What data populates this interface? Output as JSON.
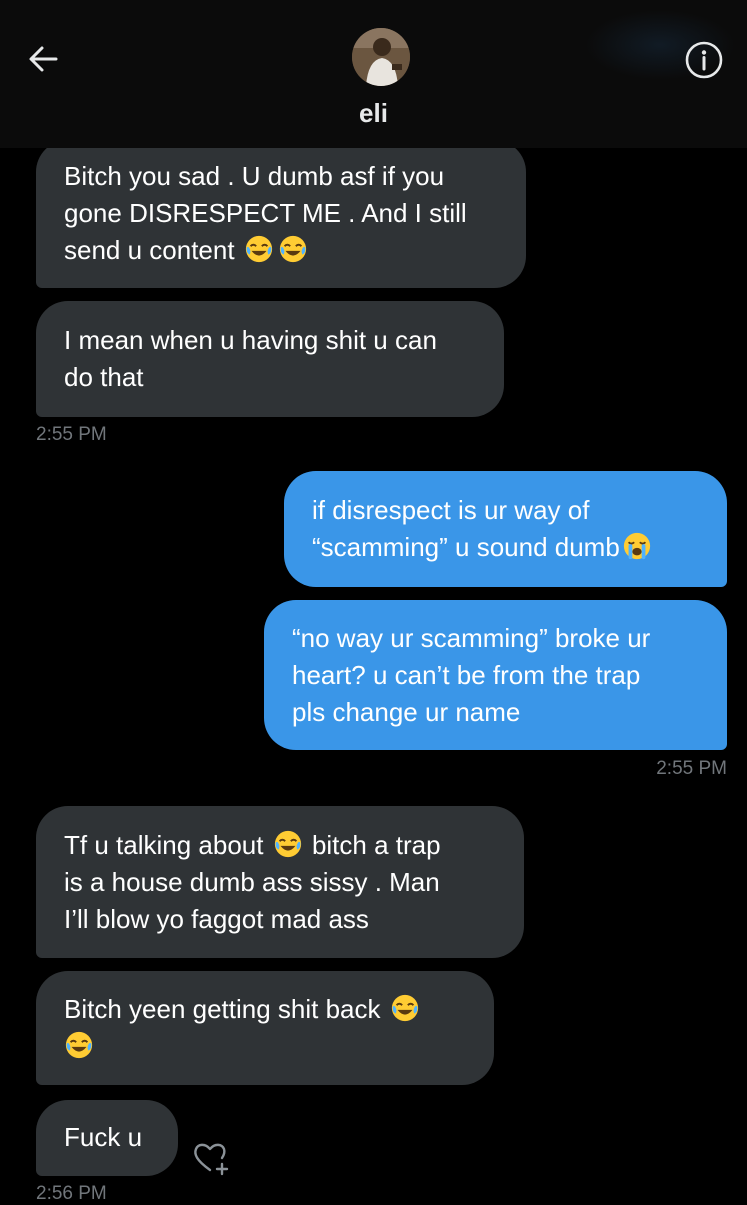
{
  "header": {
    "contact_name": "eli",
    "back_icon": "arrow-left-icon",
    "info_icon": "info-icon"
  },
  "colors": {
    "background": "#000000",
    "incoming_bubble": "#2f3336",
    "outgoing_bubble": "#3a96e8",
    "timestamp": "#71767b"
  },
  "messages": [
    {
      "direction": "in",
      "lines": [
        "Bitch you sad . U dumb asf if you",
        "gone DISRESPECT ME . And I still",
        "send u content"
      ],
      "emoji_after_last_line": [
        "laughing-tears",
        "laughing-tears"
      ]
    },
    {
      "direction": "in",
      "lines": [
        "I mean when u having shit u can",
        "do that"
      ]
    },
    {
      "direction": "out",
      "lines": [
        "if disrespect is ur way of",
        "“scamming” u sound dumb"
      ],
      "emoji_after_last_line": [
        "loudly-crying"
      ]
    },
    {
      "direction": "out",
      "lines": [
        "“no way ur scamming” broke ur",
        "heart? u can’t be from the trap",
        "pls change ur name"
      ]
    },
    {
      "direction": "in",
      "lines": [
        "Tf u talking about",
        "is a house dumb ass sissy . Man",
        "I’ll blow yo faggot mad ass"
      ],
      "first_line_tail": "bitch a trap",
      "emoji_mid_first_line": [
        "laughing-tears"
      ]
    },
    {
      "direction": "in",
      "lines": [
        "Bitch yeen getting shit back",
        ""
      ],
      "emoji_after_first_line": [
        "laughing-tears"
      ],
      "emoji_second_line": [
        "laughing-tears"
      ]
    },
    {
      "direction": "in",
      "lines": [
        "Fuck u"
      ]
    }
  ],
  "timestamps": {
    "t1": "2:55 PM",
    "t2": "2:55 PM",
    "t3": "2:56 PM"
  },
  "react_icon": "heart-plus-icon"
}
